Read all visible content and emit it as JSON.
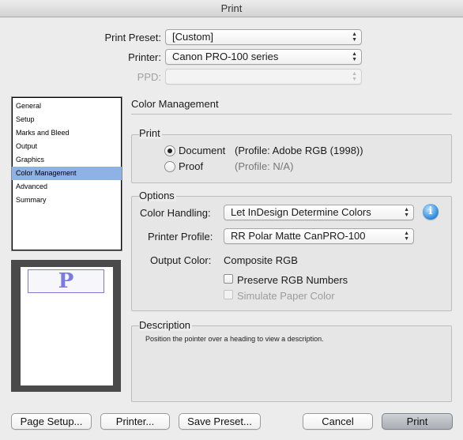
{
  "window": {
    "title": "Print"
  },
  "header": {
    "print_preset": {
      "label": "Print Preset:",
      "value": "[Custom]"
    },
    "printer": {
      "label": "Printer:",
      "value": "Canon PRO-100 series"
    },
    "ppd": {
      "label": "PPD:",
      "value": ""
    }
  },
  "sidebar": {
    "items": [
      {
        "label": "General"
      },
      {
        "label": "Setup"
      },
      {
        "label": "Marks and Bleed"
      },
      {
        "label": "Output"
      },
      {
        "label": "Graphics"
      },
      {
        "label": "Color Management",
        "selected": true
      },
      {
        "label": "Advanced"
      },
      {
        "label": "Summary"
      }
    ]
  },
  "preview": {
    "glyph": "P"
  },
  "main": {
    "section_title": "Color Management",
    "print_group": {
      "title": "Print",
      "document": {
        "label": "Document",
        "profile": "(Profile: Adobe RGB (1998))",
        "checked": true
      },
      "proof": {
        "label": "Proof",
        "profile": "(Profile: N/A)",
        "checked": false
      }
    },
    "options_group": {
      "title": "Options",
      "color_handling": {
        "label": "Color Handling:",
        "value": "Let InDesign Determine Colors"
      },
      "printer_profile": {
        "label": "Printer Profile:",
        "value": "RR Polar Matte CanPRO-100"
      },
      "output_color": {
        "label": "Output Color:",
        "value": "Composite RGB"
      },
      "preserve_rgb": {
        "label": "Preserve RGB Numbers",
        "checked": false
      },
      "simulate_paper": {
        "label": "Simulate Paper Color",
        "checked": false,
        "disabled": true
      }
    },
    "description_group": {
      "title": "Description",
      "text": "Position the pointer over a heading to view a description."
    }
  },
  "footer": {
    "page_setup": "Page Setup...",
    "printer": "Printer...",
    "save_preset": "Save Preset...",
    "cancel": "Cancel",
    "print": "Print"
  },
  "icons": {
    "info": "info-icon",
    "popup_arrows": "up-down-arrows-icon"
  }
}
